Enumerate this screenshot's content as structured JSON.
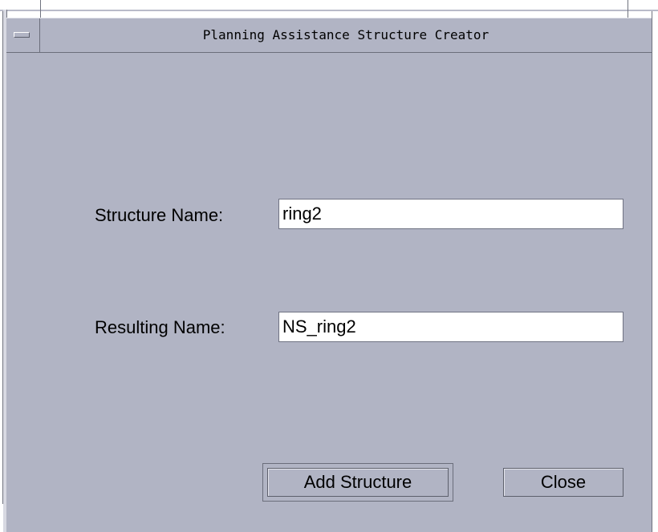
{
  "window": {
    "title": "Planning Assistance Structure Creator"
  },
  "form": {
    "structure_name_label": "Structure Name:",
    "structure_name_value": "ring2",
    "resulting_name_label": "Resulting Name:",
    "resulting_name_value": "NS_ring2"
  },
  "buttons": {
    "add_structure_label": "Add Structure",
    "close_label": "Close"
  },
  "icons": {
    "window_menu": "window-menu-icon"
  },
  "colors": {
    "background": "#b1b4c4",
    "input_background": "#ffffff"
  }
}
